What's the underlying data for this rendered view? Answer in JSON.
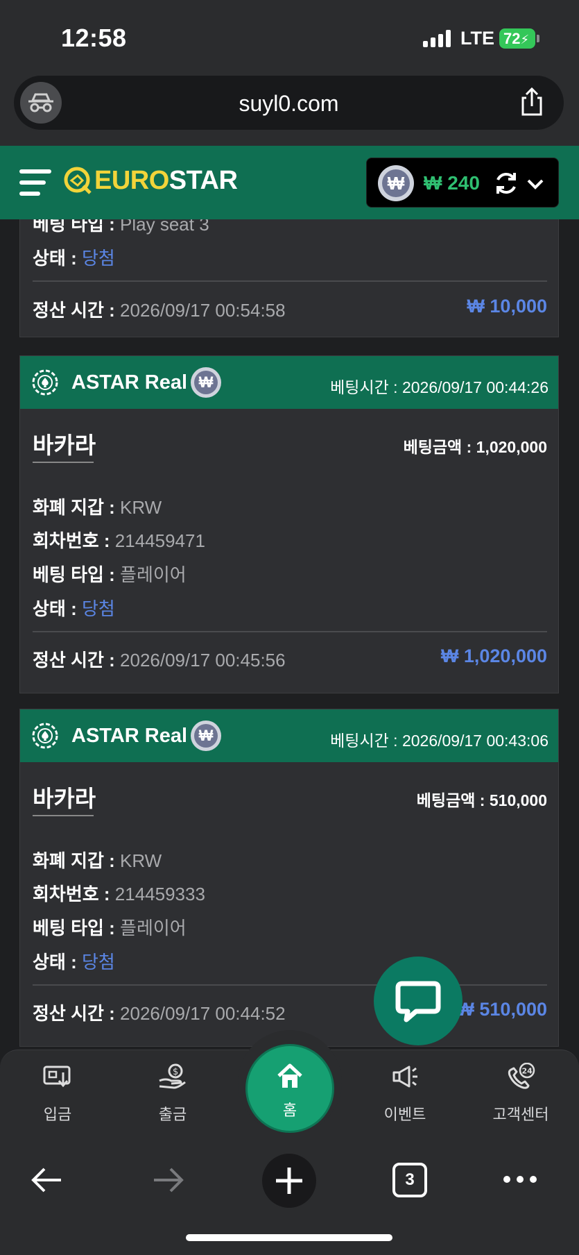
{
  "status_bar": {
    "time": "12:58",
    "network": "LTE",
    "battery": "72"
  },
  "browser": {
    "url": "suyl0.com",
    "tab_count": "3"
  },
  "header": {
    "logo_part1": "EURO",
    "logo_part2": "STAR",
    "currency_symbol": "₩",
    "balance": "₩ 240"
  },
  "partial_card": {
    "bet_type_label": "베팅 타입 :",
    "bet_type_value": "Play seat 3",
    "status_label": "상태 :",
    "status_value": "당첨",
    "settle_label": "정산 시간 :",
    "settle_time": "2026/09/17 00:54:58",
    "settle_amount": "₩ 10,000"
  },
  "cards": [
    {
      "provider": "ASTAR Real",
      "bet_time_label": "베팅시간 :",
      "bet_time": "2026/09/17 00:44:26",
      "game": "바카라",
      "bet_amount_label": "베팅금액 :",
      "bet_amount": "1,020,000",
      "wallet_label": "화폐 지갑 :",
      "wallet": "KRW",
      "round_label": "회차번호 :",
      "round": "214459471",
      "bet_type_label": "베팅 타입 :",
      "bet_type": "플레이어",
      "status_label": "상태 :",
      "status": "당첨",
      "settle_label": "정산 시간 :",
      "settle_time": "2026/09/17 00:45:56",
      "settle_amount": "₩ 1,020,000"
    },
    {
      "provider": "ASTAR Real",
      "bet_time_label": "베팅시간 :",
      "bet_time": "2026/09/17 00:43:06",
      "game": "바카라",
      "bet_amount_label": "베팅금액 :",
      "bet_amount": "510,000",
      "wallet_label": "화폐 지갑 :",
      "wallet": "KRW",
      "round_label": "회차번호 :",
      "round": "214459333",
      "bet_type_label": "베팅 타입 :",
      "bet_type": "플레이어",
      "status_label": "상태 :",
      "status": "당첨",
      "settle_label": "정산 시간 :",
      "settle_time": "2026/09/17 00:44:52",
      "settle_amount": "₩ 510,000"
    }
  ],
  "bottom_nav": {
    "deposit": "입금",
    "withdraw": "출금",
    "home": "홈",
    "event": "이벤트",
    "support": "고객센터",
    "support_badge": "24"
  },
  "colors": {
    "brand_green": "#0f6f52",
    "logo_yellow": "#f2d43a",
    "balance_green": "#2fbf71",
    "win_blue": "#5b86e5"
  },
  "icons": [
    "incognito-icon",
    "share-icon",
    "hamburger-icon",
    "refresh-icon",
    "chevron-down-icon",
    "casino-chip-icon",
    "won-coin-icon",
    "chat-icon",
    "deposit-icon",
    "withdraw-icon",
    "home-icon",
    "megaphone-icon",
    "support-24-icon",
    "back-icon",
    "forward-icon",
    "plus-icon",
    "tabs-icon",
    "more-icon"
  ]
}
